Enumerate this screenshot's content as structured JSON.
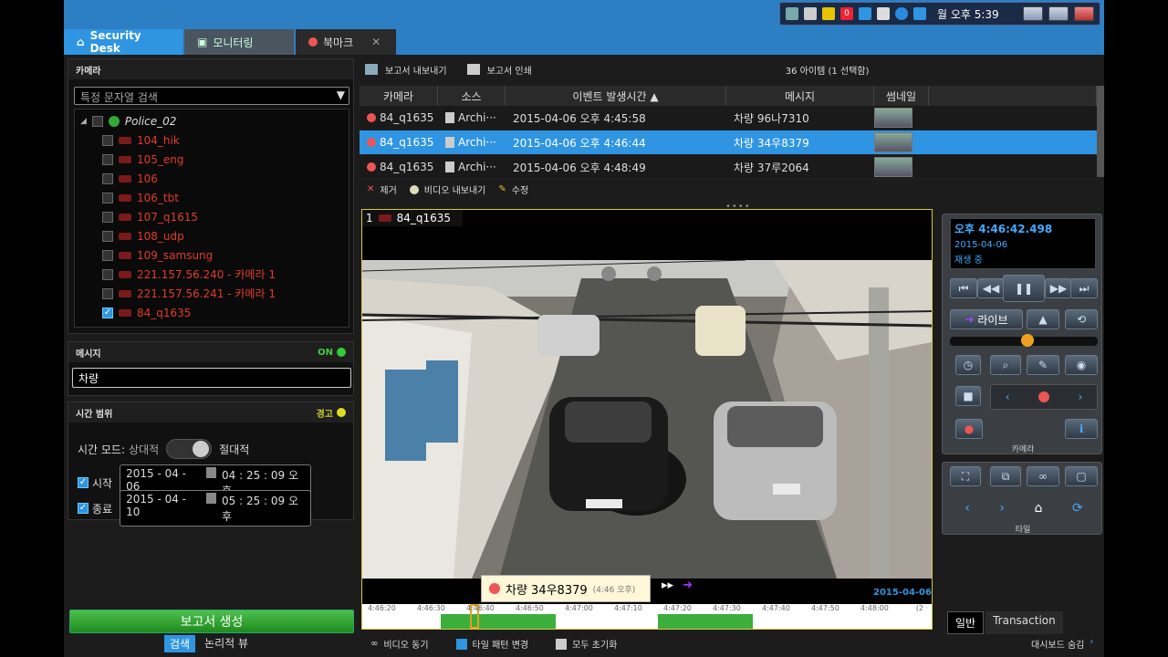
{
  "tray": {
    "time": "월 오후 5:39",
    "badge": "0"
  },
  "tabs": [
    {
      "label": "Security Desk"
    },
    {
      "label": "모니터링"
    },
    {
      "label": "북마크"
    }
  ],
  "camera_panel": {
    "title": "카메라",
    "search_placeholder": "특정 문자열 검색",
    "root": "Police_02",
    "items": [
      "104_hik",
      "105_eng",
      "106",
      "106_tbt",
      "107_q1615",
      "108_udp",
      "109_samsung",
      "221.157.56.240 - 카메라 1",
      "221.157.56.241 - 카메라 1",
      "84_q1635"
    ]
  },
  "message_panel": {
    "title": "메시지",
    "status": "ON",
    "value": "차량"
  },
  "time_panel": {
    "title": "시간 범위",
    "status": "경고",
    "mode_label": "시간 모드:",
    "mode_relative": "상대적",
    "mode_absolute": "절대적",
    "start_label": "시작",
    "start_date": "2015 - 04 - 06",
    "start_time": "04 : 25 : 09 오후",
    "end_label": "종료",
    "end_date": "2015 - 04 - 10",
    "end_time": "05 : 25 : 09 오후"
  },
  "generate_button": "보고서 생성",
  "bottom_tabs": {
    "search": "검색",
    "logical": "논리적 뷰"
  },
  "report_toolbar": {
    "export": "보고서 내보내기",
    "print": "보고서 인쇄",
    "count": "36 아이템 (1 선택함)"
  },
  "table": {
    "columns": [
      "카메라",
      "소스",
      "이벤트 발생시간 ▲",
      "메시지",
      "썸네일"
    ],
    "rows": [
      {
        "camera": "84_q1635",
        "source": "Archi···",
        "time": "2015-04-06 오후 4:45:58",
        "message": "차량 96나7310"
      },
      {
        "camera": "84_q1635",
        "source": "Archi···",
        "time": "2015-04-06 오후 4:46:44",
        "message": "차량 34우8379"
      },
      {
        "camera": "84_q1635",
        "source": "Archi···",
        "time": "2015-04-06 오후 4:48:49",
        "message": "차량 37루2064"
      }
    ],
    "selected_row": 1
  },
  "action_bar": {
    "remove": "제거",
    "export_video": "비디오 내보내기",
    "edit": "수정"
  },
  "video": {
    "tile_no": "1",
    "camera": "84_q1635",
    "overlay_text": "차량 34우8379",
    "overlay_time": "(4:46 오후)",
    "date": "2015-04-06",
    "timeline_ticks": [
      "4:46:20",
      "4:46:30",
      "4:46:40",
      "4:46:50",
      "4:47:00",
      "4:47:10",
      "4:47:20",
      "4:47:30",
      "4:47:40",
      "4:47:50",
      "4:48:00"
    ],
    "timeline_end": "(2 ·"
  },
  "playback": {
    "time": "오후 4:46:42.498",
    "date": "2015-04-06",
    "status": "재생 중",
    "live": "라이브",
    "section_camera": "카메라",
    "section_tile": "타일"
  },
  "bottom_bar": {
    "unsync": "비디오 동기",
    "tile_pattern": "타일 패턴 변경",
    "reset_all": "모두 초기화",
    "dashboard": "대시보드 숨김"
  },
  "right_tabs": {
    "general": "일반",
    "transaction": "Transaction"
  },
  "colors": {
    "accent": "#2f95e2",
    "red_cam": "#e23b2a",
    "green": "#2faa2f",
    "orange": "#f0a020"
  }
}
